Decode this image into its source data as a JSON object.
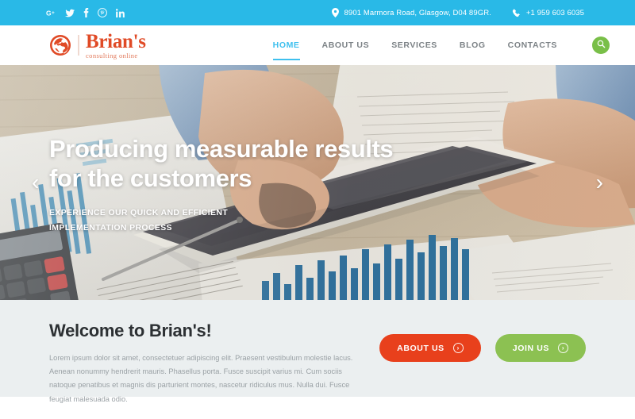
{
  "topbar": {
    "social": [
      {
        "name": "google-plus-icon",
        "label": "G+"
      },
      {
        "name": "twitter-icon",
        "label": "Twitter"
      },
      {
        "name": "facebook-icon",
        "label": "f"
      },
      {
        "name": "pinterest-icon",
        "label": "Pinterest"
      },
      {
        "name": "linkedin-icon",
        "label": "in"
      }
    ],
    "address": "8901 Marmora Road, Glasgow, D04 89GR.",
    "phone": "+1 959 603 6035",
    "bg_color": "#29b9e7"
  },
  "header": {
    "logo_name": "Brian's",
    "logo_tagline": "consulting online",
    "logo_color": "#e04a26",
    "nav": [
      {
        "label": "HOME",
        "active": true
      },
      {
        "label": "ABOUT US",
        "active": false
      },
      {
        "label": "SERVICES",
        "active": false
      },
      {
        "label": "BLOG",
        "active": false
      },
      {
        "label": "CONTACTS",
        "active": false
      }
    ],
    "accent_color": "#3fc0ee",
    "search_button_color": "#79bf48"
  },
  "hero": {
    "title_line1": "Producing measurable results",
    "title_line2": "for the customers",
    "subtitle_line1": "EXPERIENCE OUR QUICK AND EFFICIENT",
    "subtitle_line2": "IMPLEMENTATION PROCESS",
    "prev_arrow": "‹",
    "next_arrow": "›"
  },
  "welcome": {
    "title": "Welcome to Brian's!",
    "paragraph": "Lorem ipsum dolor sit amet, consectetuer adipiscing elit. Praesent vestibulum molestie lacus. Aenean nonummy hendrerit mauris. Phasellus porta. Fusce suscipit varius mi. Cum sociis natoque penatibus et magnis dis parturient montes, nascetur ridiculus mus. Nulla dui. Fusce feugiat malesuada odio.",
    "bg_color": "#ebeff0",
    "buttons": [
      {
        "label": "ABOUT US",
        "color": "#e8401c",
        "arrow": "›"
      },
      {
        "label": "JOIN US",
        "color": "#8cc152",
        "arrow": "›"
      }
    ]
  }
}
